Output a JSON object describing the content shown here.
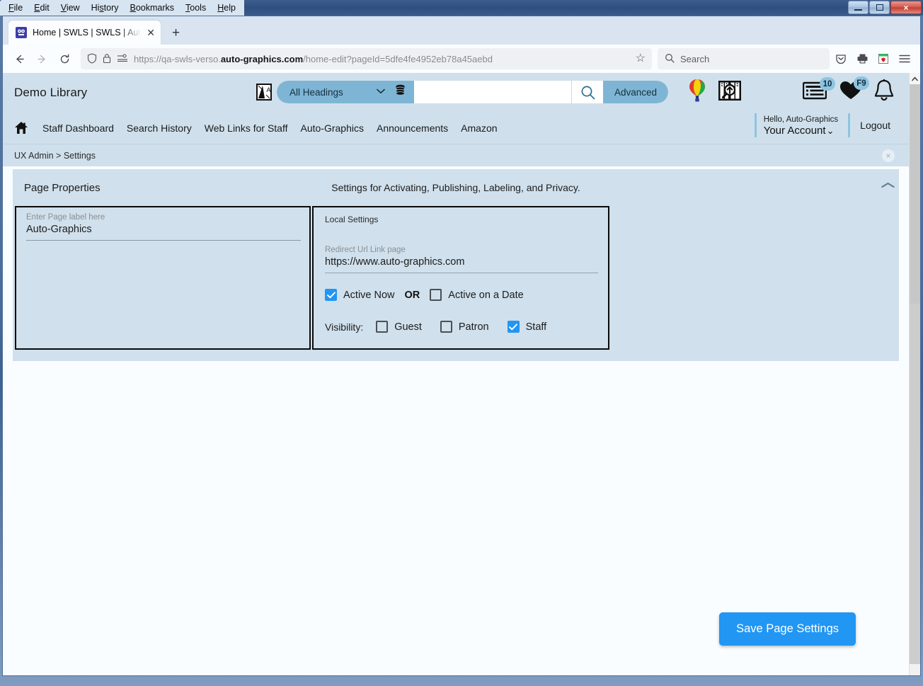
{
  "os": {
    "menus": [
      {
        "label": "File",
        "accel": "F"
      },
      {
        "label": "Edit",
        "accel": "E"
      },
      {
        "label": "View",
        "accel": "V"
      },
      {
        "label": "History",
        "accel": "s"
      },
      {
        "label": "Bookmarks",
        "accel": "B"
      },
      {
        "label": "Tools",
        "accel": "T"
      },
      {
        "label": "Help",
        "accel": "H"
      }
    ],
    "minimize": "minimize-button",
    "maximize": "maximize-button",
    "close": "×"
  },
  "browser": {
    "tab": {
      "title": "Home | SWLS | SWLS | Auto-Gra",
      "close": "✕",
      "favicon": "page-favicon"
    },
    "new_tab": "+",
    "back": "←",
    "forward": "→",
    "reload": "⟳",
    "url_prefix": "https://qa-swls-verso.",
    "url_domain": "auto-graphics.com",
    "url_suffix": "/home-edit?pageId=5dfe4fe4952eb78a45aebd",
    "bookmark_star": "☆",
    "search_placeholder": "Search",
    "toolbar_icons": [
      "pocket-icon",
      "print-icon",
      "extension-icon",
      "hamburger-menu-icon"
    ]
  },
  "app": {
    "library_name": "Demo Library",
    "search": {
      "accessibility_icon": "accessibility-icon",
      "scope_label": "All Headings",
      "database_icon": "database-icon",
      "input_value": "",
      "input_placeholder": "",
      "go_icon": "search-icon",
      "advanced_label": "Advanced"
    },
    "header_icons": [
      {
        "name": "balloon-icon",
        "badge": null
      },
      {
        "name": "book-search-icon",
        "badge": null
      },
      {
        "name": "news-list-icon",
        "badge": "10"
      },
      {
        "name": "heart-favorites-icon",
        "badge": "F9"
      },
      {
        "name": "bell-notifications-icon",
        "badge": null
      }
    ],
    "nav_links": [
      "Staff Dashboard",
      "Search History",
      "Web Links for Staff",
      "Auto-Graphics",
      "Announcements",
      "Amazon"
    ],
    "home_icon": "home-icon",
    "account": {
      "greeting": "Hello, Auto-Graphics",
      "account_label": "Your Account",
      "chevron": "⌄",
      "logout_label": "Logout"
    },
    "breadcrumb": "UX Admin > Settings",
    "breadcrumb_close": "×"
  },
  "panel": {
    "title": "Page Properties",
    "subtitle": "Settings for Activating, Publishing, Labeling, and Privacy.",
    "collapse_icon": "^",
    "left_card": {
      "label_hint": "Enter Page label here",
      "page_label": "Auto-Graphics"
    },
    "right_card": {
      "section_title": "Local Settings",
      "redirect_hint": "Redirect Url Link page",
      "redirect_value": "https://www.auto-graphics.com",
      "active_now": {
        "label": "Active Now",
        "checked": true
      },
      "or_text": "OR",
      "active_on_date": {
        "label": "Active on a Date",
        "checked": false
      },
      "visibility_label": "Visibility:",
      "visibility_options": [
        {
          "label": "Guest",
          "checked": false
        },
        {
          "label": "Patron",
          "checked": false
        },
        {
          "label": "Staff",
          "checked": true
        }
      ]
    }
  },
  "actions": {
    "save_label": "Save Page Settings"
  },
  "colors": {
    "accent_blue": "#2196f3",
    "header_bg": "#cfe0ec",
    "pill_blue": "#7fb5d4",
    "badge_blue": "#8fc4e0"
  },
  "scrollbar": {
    "up": "▲",
    "down": "▼"
  }
}
